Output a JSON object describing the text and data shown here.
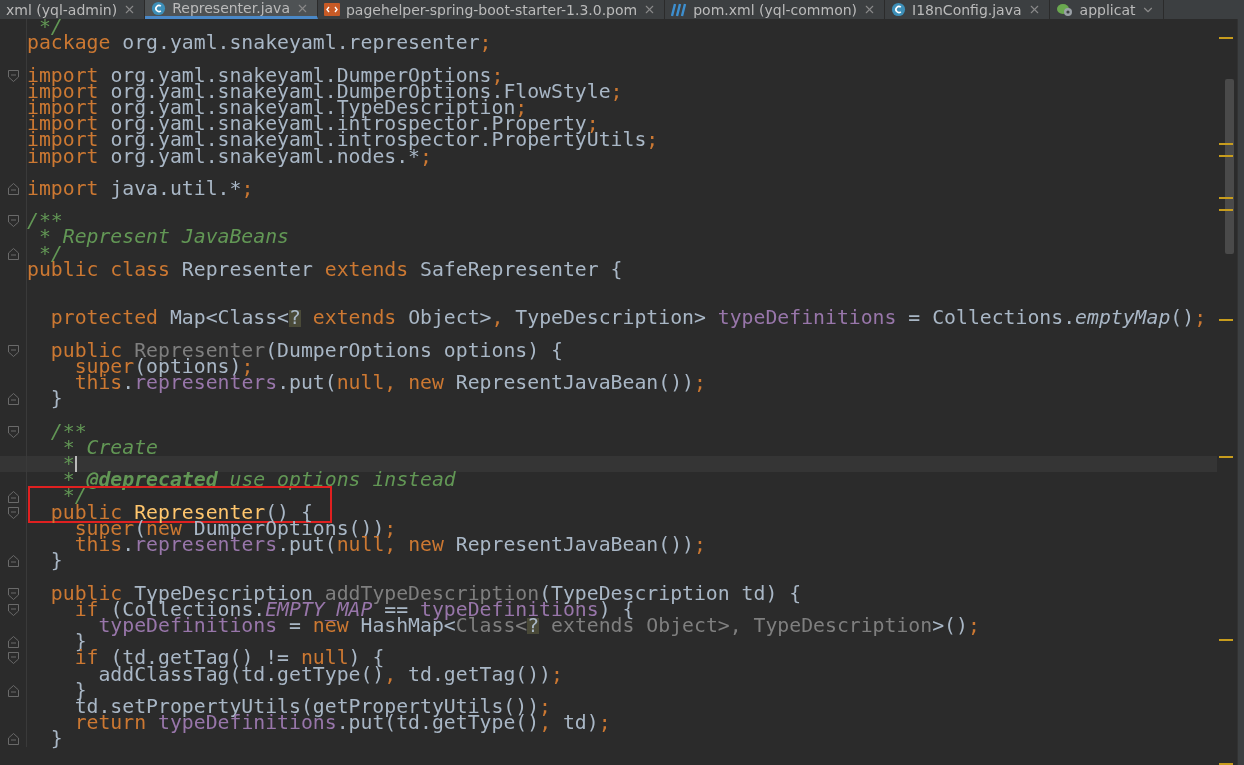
{
  "tabs": [
    {
      "label": "xml (yql-admin)",
      "kind": "plain",
      "selected": false,
      "closable": true
    },
    {
      "label": "Representer.java",
      "kind": "class",
      "selected": true,
      "closable": true
    },
    {
      "label": "pagehelper-spring-boot-starter-1.3.0.pom",
      "kind": "xml",
      "selected": false,
      "closable": true
    },
    {
      "label": "pom.xml (yql-common)",
      "kind": "maven",
      "selected": false,
      "closable": true
    },
    {
      "label": "I18nConfig.java",
      "kind": "class",
      "selected": false,
      "closable": true
    },
    {
      "label": "applicat",
      "kind": "spring",
      "selected": false,
      "closable": false
    }
  ],
  "editor": {
    "lines": [
      {
        "kind": "plain",
        "current": false,
        "boxed": false,
        "tokens": [
          {
            "text": " */",
            "kind": "doc"
          }
        ]
      },
      {
        "kind": "plain",
        "current": false,
        "boxed": false,
        "tokens": [
          {
            "text": "package ",
            "kind": "kw"
          },
          {
            "text": "org.yaml.snakeyaml.representer",
            "kind": "plain"
          },
          {
            "text": ";",
            "kind": "kw"
          }
        ]
      },
      {
        "kind": "plain",
        "current": false,
        "boxed": false
      },
      {
        "kind": "fold-start",
        "current": false,
        "boxed": false,
        "tokens": [
          {
            "text": "import ",
            "kind": "kw"
          },
          {
            "text": "org.yaml.snakeyaml.DumperOptions",
            "kind": "plain"
          },
          {
            "text": ";",
            "kind": "kw"
          }
        ]
      },
      {
        "kind": "plain",
        "current": false,
        "boxed": false,
        "tokens": [
          {
            "text": "import ",
            "kind": "kw"
          },
          {
            "text": "org.yaml.snakeyaml.DumperOptions.FlowStyle",
            "kind": "plain"
          },
          {
            "text": ";",
            "kind": "kw"
          }
        ]
      },
      {
        "kind": "plain",
        "current": false,
        "boxed": false,
        "tokens": [
          {
            "text": "import ",
            "kind": "kw"
          },
          {
            "text": "org.yaml.snakeyaml.TypeDescription",
            "kind": "plain"
          },
          {
            "text": ";",
            "kind": "kw"
          }
        ]
      },
      {
        "kind": "plain",
        "current": false,
        "boxed": false,
        "tokens": [
          {
            "text": "import ",
            "kind": "kw"
          },
          {
            "text": "org.yaml.snakeyaml.introspector.Property",
            "kind": "plain"
          },
          {
            "text": ";",
            "kind": "kw"
          }
        ]
      },
      {
        "kind": "plain",
        "current": false,
        "boxed": false,
        "tokens": [
          {
            "text": "import ",
            "kind": "kw"
          },
          {
            "text": "org.yaml.snakeyaml.introspector.PropertyUtils",
            "kind": "plain"
          },
          {
            "text": ";",
            "kind": "kw"
          }
        ]
      },
      {
        "kind": "plain",
        "current": false,
        "boxed": false,
        "tokens": [
          {
            "text": "import ",
            "kind": "kw"
          },
          {
            "text": "org.yaml.snakeyaml.nodes.*",
            "kind": "plain"
          },
          {
            "text": ";",
            "kind": "kw"
          }
        ]
      },
      {
        "kind": "plain",
        "current": false,
        "boxed": false
      },
      {
        "kind": "fold-end",
        "current": false,
        "boxed": false,
        "tokens": [
          {
            "text": "import ",
            "kind": "kw"
          },
          {
            "text": "java.util.*",
            "kind": "plain"
          },
          {
            "text": ";",
            "kind": "kw"
          }
        ]
      },
      {
        "kind": "plain",
        "current": false,
        "boxed": false
      },
      {
        "kind": "fold-start",
        "current": false,
        "boxed": false,
        "tokens": [
          {
            "text": "/**",
            "kind": "doc"
          }
        ]
      },
      {
        "kind": "plain",
        "current": false,
        "boxed": false,
        "tokens": [
          {
            "text": " * Represent JavaBeans",
            "kind": "doc"
          }
        ]
      },
      {
        "kind": "fold-end",
        "current": false,
        "boxed": false,
        "tokens": [
          {
            "text": " */",
            "kind": "doc"
          }
        ]
      },
      {
        "kind": "plain",
        "current": false,
        "boxed": false,
        "tokens": [
          {
            "text": "public class ",
            "kind": "kw"
          },
          {
            "text": "Representer ",
            "kind": "plain"
          },
          {
            "text": "extends ",
            "kind": "kw"
          },
          {
            "text": "SafeRepresenter {",
            "kind": "plain"
          }
        ]
      },
      {
        "kind": "plain",
        "current": false,
        "boxed": false
      },
      {
        "kind": "plain",
        "current": false,
        "boxed": false
      },
      {
        "kind": "plain",
        "current": false,
        "boxed": false,
        "tokens": [
          {
            "text": "  protected ",
            "kind": "kw"
          },
          {
            "text": "Map<Class<",
            "kind": "plain"
          },
          {
            "text": "?",
            "kind": "wild"
          },
          {
            "text": " extends ",
            "kind": "kw"
          },
          {
            "text": "Object>",
            "kind": "plain"
          },
          {
            "text": ", ",
            "kind": "kw"
          },
          {
            "text": "TypeDescription> ",
            "kind": "plain"
          },
          {
            "text": "typeDefinitions",
            "kind": "field"
          },
          {
            "text": " = Collections.",
            "kind": "plain"
          },
          {
            "text": "emptyMap",
            "kind": "italic"
          },
          {
            "text": "()",
            "kind": "plain"
          },
          {
            "text": ";",
            "kind": "kw"
          }
        ]
      },
      {
        "kind": "plain",
        "current": false,
        "boxed": false
      },
      {
        "kind": "fold-start",
        "current": false,
        "boxed": false,
        "tokens": [
          {
            "text": "  public ",
            "kind": "kw"
          },
          {
            "text": "Representer",
            "kind": "dim"
          },
          {
            "text": "(DumperOptions options) {",
            "kind": "plain"
          }
        ]
      },
      {
        "kind": "plain",
        "current": false,
        "boxed": false,
        "tokens": [
          {
            "text": "    super",
            "kind": "kw"
          },
          {
            "text": "(options)",
            "kind": "plain"
          },
          {
            "text": ";",
            "kind": "kw"
          }
        ]
      },
      {
        "kind": "plain",
        "current": false,
        "boxed": false,
        "tokens": [
          {
            "text": "    this",
            "kind": "kw"
          },
          {
            "text": ".",
            "kind": "plain"
          },
          {
            "text": "representers",
            "kind": "field"
          },
          {
            "text": ".put(",
            "kind": "plain"
          },
          {
            "text": "null, new ",
            "kind": "kw"
          },
          {
            "text": "RepresentJavaBean())",
            "kind": "plain"
          },
          {
            "text": ";",
            "kind": "kw"
          }
        ]
      },
      {
        "kind": "fold-end",
        "current": false,
        "boxed": false,
        "tokens": [
          {
            "text": "  }",
            "kind": "plain"
          }
        ]
      },
      {
        "kind": "plain",
        "current": false,
        "boxed": false
      },
      {
        "kind": "fold-start",
        "current": false,
        "boxed": false,
        "tokens": [
          {
            "text": "  /**",
            "kind": "doc"
          }
        ]
      },
      {
        "kind": "plain",
        "current": false,
        "boxed": false,
        "tokens": [
          {
            "text": "   * Create",
            "kind": "doc"
          }
        ]
      },
      {
        "kind": "plain",
        "current": true,
        "boxed": false,
        "tokens": [
          {
            "text": "   *",
            "kind": "doc"
          }
        ]
      },
      {
        "kind": "plain",
        "current": false,
        "boxed": false,
        "tokens": [
          {
            "text": "   * ",
            "kind": "doc"
          },
          {
            "text": "@deprecated",
            "kind": "doctag"
          },
          {
            "text": " use options instead",
            "kind": "doc"
          }
        ]
      },
      {
        "kind": "fold-end",
        "current": false,
        "boxed": true,
        "tokens": [
          {
            "text": "   */",
            "kind": "doc"
          }
        ]
      },
      {
        "kind": "fold-start",
        "current": false,
        "boxed": true,
        "tokens": [
          {
            "text": "  public ",
            "kind": "kw"
          },
          {
            "text": "Representer",
            "kind": "decl"
          },
          {
            "text": "() {",
            "kind": "plain"
          }
        ]
      },
      {
        "kind": "plain",
        "current": false,
        "boxed": false,
        "tokens": [
          {
            "text": "    super",
            "kind": "kw"
          },
          {
            "text": "(",
            "kind": "plain"
          },
          {
            "text": "new ",
            "kind": "kw"
          },
          {
            "text": "DumperOptions())",
            "kind": "plain"
          },
          {
            "text": ";",
            "kind": "kw"
          }
        ]
      },
      {
        "kind": "plain",
        "current": false,
        "boxed": false,
        "tokens": [
          {
            "text": "    this",
            "kind": "kw"
          },
          {
            "text": ".",
            "kind": "plain"
          },
          {
            "text": "representers",
            "kind": "field"
          },
          {
            "text": ".put(",
            "kind": "plain"
          },
          {
            "text": "null, new ",
            "kind": "kw"
          },
          {
            "text": "RepresentJavaBean())",
            "kind": "plain"
          },
          {
            "text": ";",
            "kind": "kw"
          }
        ]
      },
      {
        "kind": "fold-end",
        "current": false,
        "boxed": false,
        "tokens": [
          {
            "text": "  }",
            "kind": "plain"
          }
        ]
      },
      {
        "kind": "plain",
        "current": false,
        "boxed": false
      },
      {
        "kind": "fold-start",
        "current": false,
        "boxed": false,
        "tokens": [
          {
            "text": "  public ",
            "kind": "kw"
          },
          {
            "text": "TypeDescription ",
            "kind": "plain"
          },
          {
            "text": "addTypeDescription",
            "kind": "dim"
          },
          {
            "text": "(TypeDescription td) {",
            "kind": "plain"
          }
        ]
      },
      {
        "kind": "fold-start",
        "current": false,
        "boxed": false,
        "tokens": [
          {
            "text": "    if ",
            "kind": "kw"
          },
          {
            "text": "(Collections.",
            "kind": "plain"
          },
          {
            "text": "EMPTY_MAP",
            "kind": "static"
          },
          {
            "text": " == ",
            "kind": "plain"
          },
          {
            "text": "typeDefinitions",
            "kind": "field"
          },
          {
            "text": ") {",
            "kind": "plain"
          }
        ]
      },
      {
        "kind": "plain",
        "current": false,
        "boxed": false,
        "tokens": [
          {
            "text": "      typeDefinitions",
            "kind": "field"
          },
          {
            "text": " = ",
            "kind": "plain"
          },
          {
            "text": "new ",
            "kind": "kw"
          },
          {
            "text": "HashMap<",
            "kind": "plain"
          },
          {
            "text": "Class<",
            "kind": "dim"
          },
          {
            "text": "?",
            "kind": "wild"
          },
          {
            "text": " extends Object>, TypeDescription",
            "kind": "dim"
          },
          {
            "text": ">()",
            "kind": "plain"
          },
          {
            "text": ";",
            "kind": "kw"
          }
        ]
      },
      {
        "kind": "fold-end",
        "current": false,
        "boxed": false,
        "tokens": [
          {
            "text": "    }",
            "kind": "plain"
          }
        ]
      },
      {
        "kind": "fold-start",
        "current": false,
        "boxed": false,
        "tokens": [
          {
            "text": "    if ",
            "kind": "kw"
          },
          {
            "text": "(td.getTag() != ",
            "kind": "plain"
          },
          {
            "text": "null",
            "kind": "kw"
          },
          {
            "text": ") {",
            "kind": "plain"
          }
        ]
      },
      {
        "kind": "plain",
        "current": false,
        "boxed": false,
        "tokens": [
          {
            "text": "      addClassTag(td.getType()",
            "kind": "plain"
          },
          {
            "text": ", ",
            "kind": "kw"
          },
          {
            "text": "td.getTag())",
            "kind": "plain"
          },
          {
            "text": ";",
            "kind": "kw"
          }
        ]
      },
      {
        "kind": "fold-end",
        "current": false,
        "boxed": false,
        "tokens": [
          {
            "text": "    }",
            "kind": "plain"
          }
        ]
      },
      {
        "kind": "plain",
        "current": false,
        "boxed": false,
        "tokens": [
          {
            "text": "    td.setPropertyUtils(getPropertyUtils())",
            "kind": "plain"
          },
          {
            "text": ";",
            "kind": "kw"
          }
        ]
      },
      {
        "kind": "plain",
        "current": false,
        "boxed": false,
        "tokens": [
          {
            "text": "    return ",
            "kind": "kw"
          },
          {
            "text": "typeDefinitions",
            "kind": "field"
          },
          {
            "text": ".put(td.getType()",
            "kind": "plain"
          },
          {
            "text": ", ",
            "kind": "kw"
          },
          {
            "text": "td)",
            "kind": "plain"
          },
          {
            "text": ";",
            "kind": "kw"
          }
        ]
      },
      {
        "kind": "fold-end",
        "current": false,
        "boxed": false,
        "tokens": [
          {
            "text": "  }",
            "kind": "plain"
          }
        ]
      }
    ]
  }
}
